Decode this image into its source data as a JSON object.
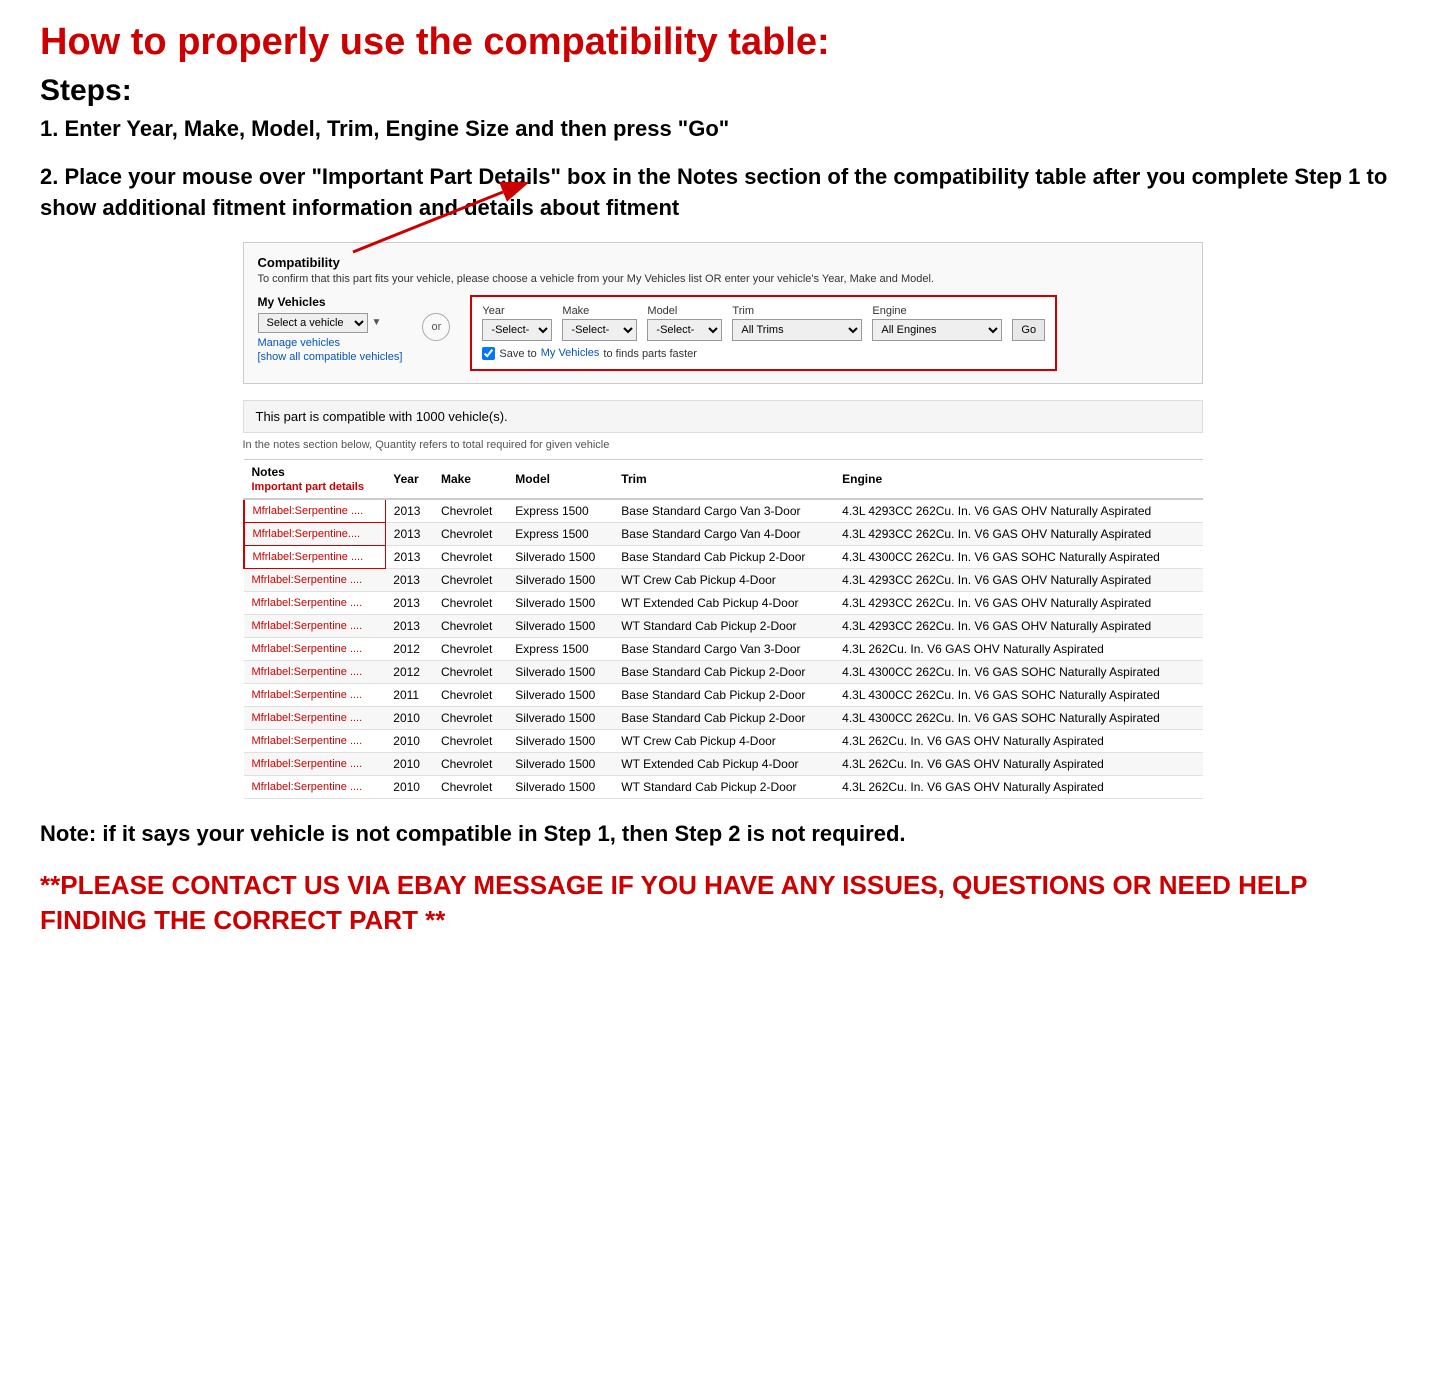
{
  "page": {
    "main_title": "How to properly use the compatibility table:",
    "steps_heading": "Steps:",
    "step1_text": "1. Enter Year, Make, Model, Trim, Engine Size and then press \"Go\"",
    "step2_text": "2. Place your mouse over \"Important Part Details\" box in the Notes section of the compatibility table after you complete Step 1 to show additional fitment information and details about fitment",
    "note_text": "Note: if it says your vehicle is not compatible in Step 1, then Step 2 is not required.",
    "contact_text": "**PLEASE CONTACT US VIA EBAY MESSAGE IF YOU HAVE ANY ISSUES, QUESTIONS OR NEED HELP FINDING THE CORRECT PART **"
  },
  "compatibility_section": {
    "title": "Compatibility",
    "subtitle": "To confirm that this part fits your vehicle, please choose a vehicle from your My Vehicles list OR enter your vehicle's Year, Make and Model.",
    "my_vehicles_label": "My Vehicles",
    "select_vehicle_placeholder": "Select a vehicle",
    "manage_vehicles_link": "Manage vehicles",
    "show_all_link": "[show all compatible vehicles]",
    "or_label": "or",
    "year_label": "Year",
    "make_label": "Make",
    "model_label": "Model",
    "trim_label": "Trim",
    "engine_label": "Engine",
    "year_default": "-Select-",
    "make_default": "-Select-",
    "model_default": "-Select-",
    "trim_default": "All Trims",
    "engine_default": "All Engines",
    "go_button": "Go",
    "save_checkbox_label": "Save to",
    "save_link_text": "My Vehicles",
    "save_suffix": "to finds parts faster",
    "compatible_count_text": "This part is compatible with 1000 vehicle(s).",
    "quantity_note": "In the notes section below, Quantity refers to total required for given vehicle"
  },
  "table": {
    "headers": [
      "Notes",
      "Year",
      "Make",
      "Model",
      "Trim",
      "Engine"
    ],
    "notes_subheader": "Important part details",
    "rows": [
      {
        "notes": "Mfrlabel:Serpentine ....",
        "year": "2013",
        "make": "Chevrolet",
        "model": "Express 1500",
        "trim": "Base Standard Cargo Van 3-Door",
        "engine": "4.3L 4293CC 262Cu. In. V6 GAS OHV Naturally Aspirated"
      },
      {
        "notes": "Mfrlabel:Serpentine....",
        "year": "2013",
        "make": "Chevrolet",
        "model": "Express 1500",
        "trim": "Base Standard Cargo Van 4-Door",
        "engine": "4.3L 4293CC 262Cu. In. V6 GAS OHV Naturally Aspirated"
      },
      {
        "notes": "Mfrlabel:Serpentine ....",
        "year": "2013",
        "make": "Chevrolet",
        "model": "Silverado 1500",
        "trim": "Base Standard Cab Pickup 2-Door",
        "engine": "4.3L 4300CC 262Cu. In. V6 GAS SOHC Naturally Aspirated"
      },
      {
        "notes": "Mfrlabel:Serpentine ....",
        "year": "2013",
        "make": "Chevrolet",
        "model": "Silverado 1500",
        "trim": "WT Crew Cab Pickup 4-Door",
        "engine": "4.3L 4293CC 262Cu. In. V6 GAS OHV Naturally Aspirated"
      },
      {
        "notes": "Mfrlabel:Serpentine ....",
        "year": "2013",
        "make": "Chevrolet",
        "model": "Silverado 1500",
        "trim": "WT Extended Cab Pickup 4-Door",
        "engine": "4.3L 4293CC 262Cu. In. V6 GAS OHV Naturally Aspirated"
      },
      {
        "notes": "Mfrlabel:Serpentine ....",
        "year": "2013",
        "make": "Chevrolet",
        "model": "Silverado 1500",
        "trim": "WT Standard Cab Pickup 2-Door",
        "engine": "4.3L 4293CC 262Cu. In. V6 GAS OHV Naturally Aspirated"
      },
      {
        "notes": "Mfrlabel:Serpentine ....",
        "year": "2012",
        "make": "Chevrolet",
        "model": "Express 1500",
        "trim": "Base Standard Cargo Van 3-Door",
        "engine": "4.3L 262Cu. In. V6 GAS OHV Naturally Aspirated"
      },
      {
        "notes": "Mfrlabel:Serpentine ....",
        "year": "2012",
        "make": "Chevrolet",
        "model": "Silverado 1500",
        "trim": "Base Standard Cab Pickup 2-Door",
        "engine": "4.3L 4300CC 262Cu. In. V6 GAS SOHC Naturally Aspirated"
      },
      {
        "notes": "Mfrlabel:Serpentine ....",
        "year": "2011",
        "make": "Chevrolet",
        "model": "Silverado 1500",
        "trim": "Base Standard Cab Pickup 2-Door",
        "engine": "4.3L 4300CC 262Cu. In. V6 GAS SOHC Naturally Aspirated"
      },
      {
        "notes": "Mfrlabel:Serpentine ....",
        "year": "2010",
        "make": "Chevrolet",
        "model": "Silverado 1500",
        "trim": "Base Standard Cab Pickup 2-Door",
        "engine": "4.3L 4300CC 262Cu. In. V6 GAS SOHC Naturally Aspirated"
      },
      {
        "notes": "Mfrlabel:Serpentine ....",
        "year": "2010",
        "make": "Chevrolet",
        "model": "Silverado 1500",
        "trim": "WT Crew Cab Pickup 4-Door",
        "engine": "4.3L 262Cu. In. V6 GAS OHV Naturally Aspirated"
      },
      {
        "notes": "Mfrlabel:Serpentine ....",
        "year": "2010",
        "make": "Chevrolet",
        "model": "Silverado 1500",
        "trim": "WT Extended Cab Pickup 4-Door",
        "engine": "4.3L 262Cu. In. V6 GAS OHV Naturally Aspirated"
      },
      {
        "notes": "Mfrlabel:Serpentine ....",
        "year": "2010",
        "make": "Chevrolet",
        "model": "Silverado 1500",
        "trim": "WT Standard Cab Pickup 2-Door",
        "engine": "4.3L 262Cu. In. V6 GAS OHV Naturally Aspirated"
      }
    ]
  }
}
